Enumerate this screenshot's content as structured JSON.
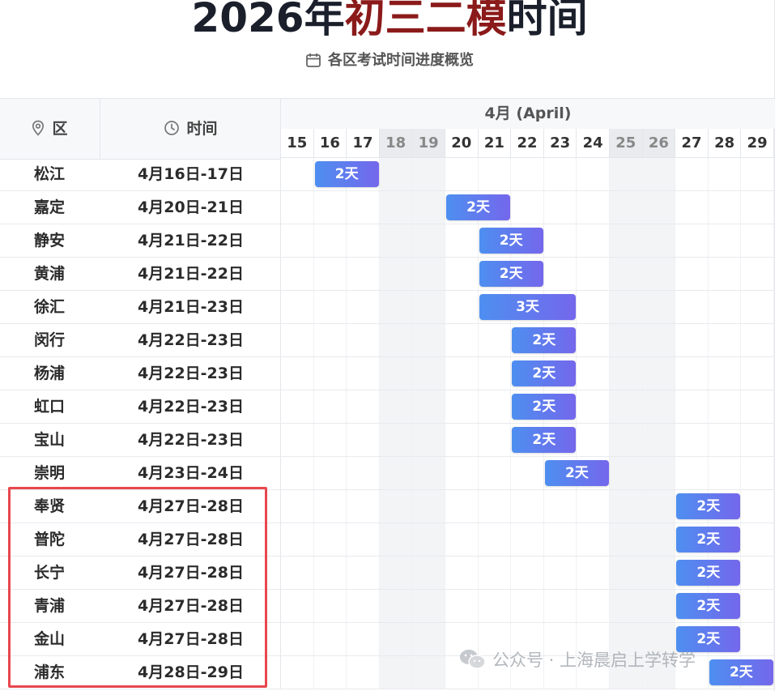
{
  "header": {
    "title_prefix": "2026年",
    "title_highlight": "初三二模",
    "title_suffix": "时间",
    "subtitle": "各区考试时间进度概览",
    "title_highlight_color": "#8b1a1a"
  },
  "table": {
    "col_district": "区",
    "col_time": "时间",
    "month_label": "4月 (April)",
    "days": [
      "15",
      "16",
      "17",
      "18",
      "19",
      "20",
      "21",
      "22",
      "23",
      "24",
      "25",
      "26",
      "27",
      "28",
      "29"
    ],
    "weekend_days": [
      "18",
      "19",
      "25",
      "26"
    ],
    "rows": [
      {
        "district": "松江",
        "time": "4月16日-17日",
        "start": 16,
        "days": 2,
        "label": "2天"
      },
      {
        "district": "嘉定",
        "time": "4月20日-21日",
        "start": 20,
        "days": 2,
        "label": "2天"
      },
      {
        "district": "静安",
        "time": "4月21日-22日",
        "start": 21,
        "days": 2,
        "label": "2天"
      },
      {
        "district": "黄浦",
        "time": "4月21日-22日",
        "start": 21,
        "days": 2,
        "label": "2天"
      },
      {
        "district": "徐汇",
        "time": "4月21日-23日",
        "start": 21,
        "days": 3,
        "label": "3天"
      },
      {
        "district": "闵行",
        "time": "4月22日-23日",
        "start": 22,
        "days": 2,
        "label": "2天"
      },
      {
        "district": "杨浦",
        "time": "4月22日-23日",
        "start": 22,
        "days": 2,
        "label": "2天"
      },
      {
        "district": "虹口",
        "time": "4月22日-23日",
        "start": 22,
        "days": 2,
        "label": "2天"
      },
      {
        "district": "宝山",
        "time": "4月22日-23日",
        "start": 22,
        "days": 2,
        "label": "2天"
      },
      {
        "district": "崇明",
        "time": "4月23日-24日",
        "start": 23,
        "days": 2,
        "label": "2天"
      },
      {
        "district": "奉贤",
        "time": "4月27日-28日",
        "start": 27,
        "days": 2,
        "label": "2天"
      },
      {
        "district": "普陀",
        "time": "4月27日-28日",
        "start": 27,
        "days": 2,
        "label": "2天"
      },
      {
        "district": "长宁",
        "time": "4月27日-28日",
        "start": 27,
        "days": 2,
        "label": "2天"
      },
      {
        "district": "青浦",
        "time": "4月27日-28日",
        "start": 27,
        "days": 2,
        "label": "2天"
      },
      {
        "district": "金山",
        "time": "4月27日-28日",
        "start": 27,
        "days": 2,
        "label": "2天"
      },
      {
        "district": "浦东",
        "time": "4月28日-29日",
        "start": 28,
        "days": 2,
        "label": "2天"
      }
    ]
  },
  "watermark": "公众号 · 上海晨启上学转学",
  "colors": {
    "bar_start": "#4e8ff0",
    "bar_end": "#7467ec",
    "highlight_box": "#e8474d"
  }
}
